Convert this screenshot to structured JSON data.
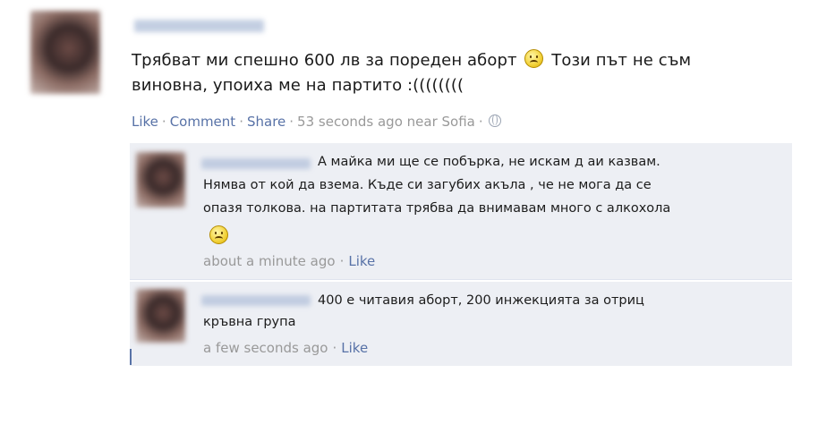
{
  "post": {
    "text_line1": "Трябват ми спешно 600 лв за пореден аборт",
    "text_line1b": "Този път не съм",
    "text_line2": "виновна, упоиха ме на партито :((((((((",
    "actions": {
      "like": "Like",
      "comment": "Comment",
      "share": "Share",
      "timestamp": "53 seconds ago near Sofia"
    }
  },
  "comments": [
    {
      "lines": [
        "А майка ми ще се побърка, не искам д аи казвам.",
        "Нямва от кой да взема. Къде си загубих акъла , че не мога да се",
        "опазя толкова. на партитата трябва да внимавам много с алкохола"
      ],
      "timestamp": "about a minute ago",
      "like": "Like"
    },
    {
      "lines": [
        "400 е читавия аборт, 200 инжекцията за отриц",
        "кръвна група"
      ],
      "timestamp": "a few seconds ago",
      "like": "Like"
    }
  ],
  "icons": {
    "emoticon": "frown-emoticon-icon",
    "privacy": "globe-icon"
  },
  "colors": {
    "link": "#5872a7",
    "comment_bg": "#edeff4",
    "meta_gray": "#999999"
  }
}
